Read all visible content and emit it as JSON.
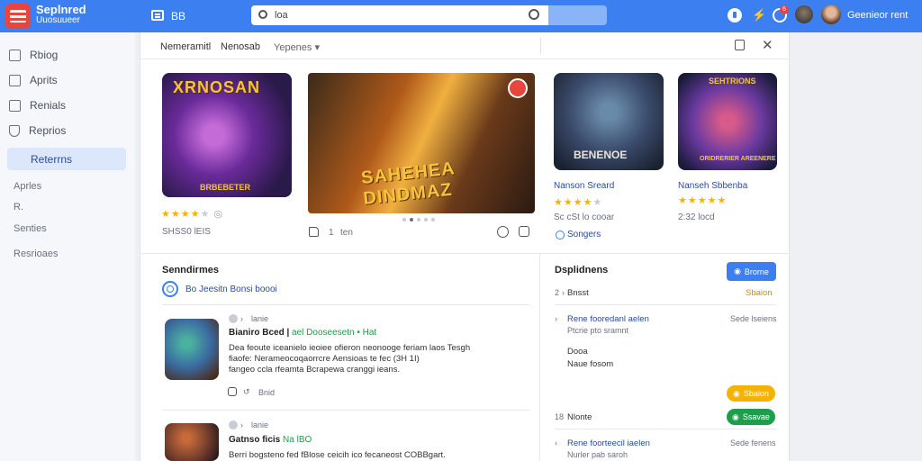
{
  "header": {
    "brand_line1": "Seplnred",
    "brand_line2": "Uuosuueer",
    "menu_label": "BB",
    "search_value": "loa",
    "notif_count": "6",
    "user_name": "Geenieor rent"
  },
  "sidebar": {
    "items": [
      {
        "label": "Rbiog"
      },
      {
        "label": "Aprits"
      },
      {
        "label": "Renials"
      },
      {
        "label": "Reprios"
      }
    ],
    "active_label": "Reterrns",
    "sub_items": [
      {
        "label": "Aprles"
      },
      {
        "label": "R."
      },
      {
        "label": "Senties"
      },
      {
        "label": "Resrioaes"
      }
    ]
  },
  "main": {
    "tabs": [
      {
        "label": "Nemeramitl"
      },
      {
        "label": "Nenosab"
      },
      {
        "label": "Yepenes"
      }
    ],
    "featured": [
      {
        "title": "XRNOSAN",
        "sub": "BRBEBETER",
        "rating": 4,
        "meta": "SHSS0 lEIS"
      },
      {
        "title": "SAHEHEA DINDMAZ",
        "likes": "1",
        "like_label": "ten"
      },
      {
        "title": "BENENOE",
        "name": "Nanson Sreard",
        "rating": 4,
        "meta": "Sc cSt lo cooar",
        "link": "Songers"
      },
      {
        "title": "SEHTRIONS",
        "sub": "ORIDRERIER AREENERE",
        "name": "Nanseh Sbbenba",
        "rating": 5,
        "meta": "2:32 locd"
      }
    ],
    "section_title": "Senndirmes",
    "section_link": "Bo Jeesitn Bonsi boooi",
    "posts": [
      {
        "meta": "lanie",
        "title": "Bianiro Bced |",
        "title_green": "ael Dooseesetn",
        "title_tail": "• Hat",
        "body_1": "Dea feoute iceanielo ieoiee ofieron neonooge feriam laos Tesgh",
        "body_2": "fiaofe: Nerameocoqaorrcre Aensioas te fec (3H 1I)",
        "body_3": "fangeo ccla rfeamta Bcrapewa cranggi ieans.",
        "action": "Bnid"
      },
      {
        "meta": "lanie",
        "title": "Gatnso ficis",
        "title_green": "Na lBO",
        "body_1": "Berri bogsteno fed fBlose ceicih ico fecaneost COBBgart."
      }
    ]
  },
  "right": {
    "title": "Dsplidnens",
    "button": "Brorne",
    "rows": [
      {
        "num": "2",
        "label": "Bnsst",
        "value": "Sbaion"
      },
      {
        "link": "Rene fooredanl aelen",
        "value": "Sede lseiens",
        "sub": "Ptcrie pto sramnt"
      },
      {
        "item": "Dooa"
      },
      {
        "item": "Naue fosom"
      },
      {
        "num": "18",
        "label": "Nlonte"
      },
      {
        "link": "Rene foorteecil iaelen",
        "value": "Sede fenens",
        "sub": "Nurler pab saroh"
      }
    ],
    "btn_yellow": "Sbaion",
    "btn_green": "Ssavae"
  },
  "colors": {
    "topbar": "#3c7ff0",
    "accent": "#3c7ff0",
    "star": "#f5b301",
    "green": "#1e9e4a",
    "logo": "#e8453c"
  }
}
